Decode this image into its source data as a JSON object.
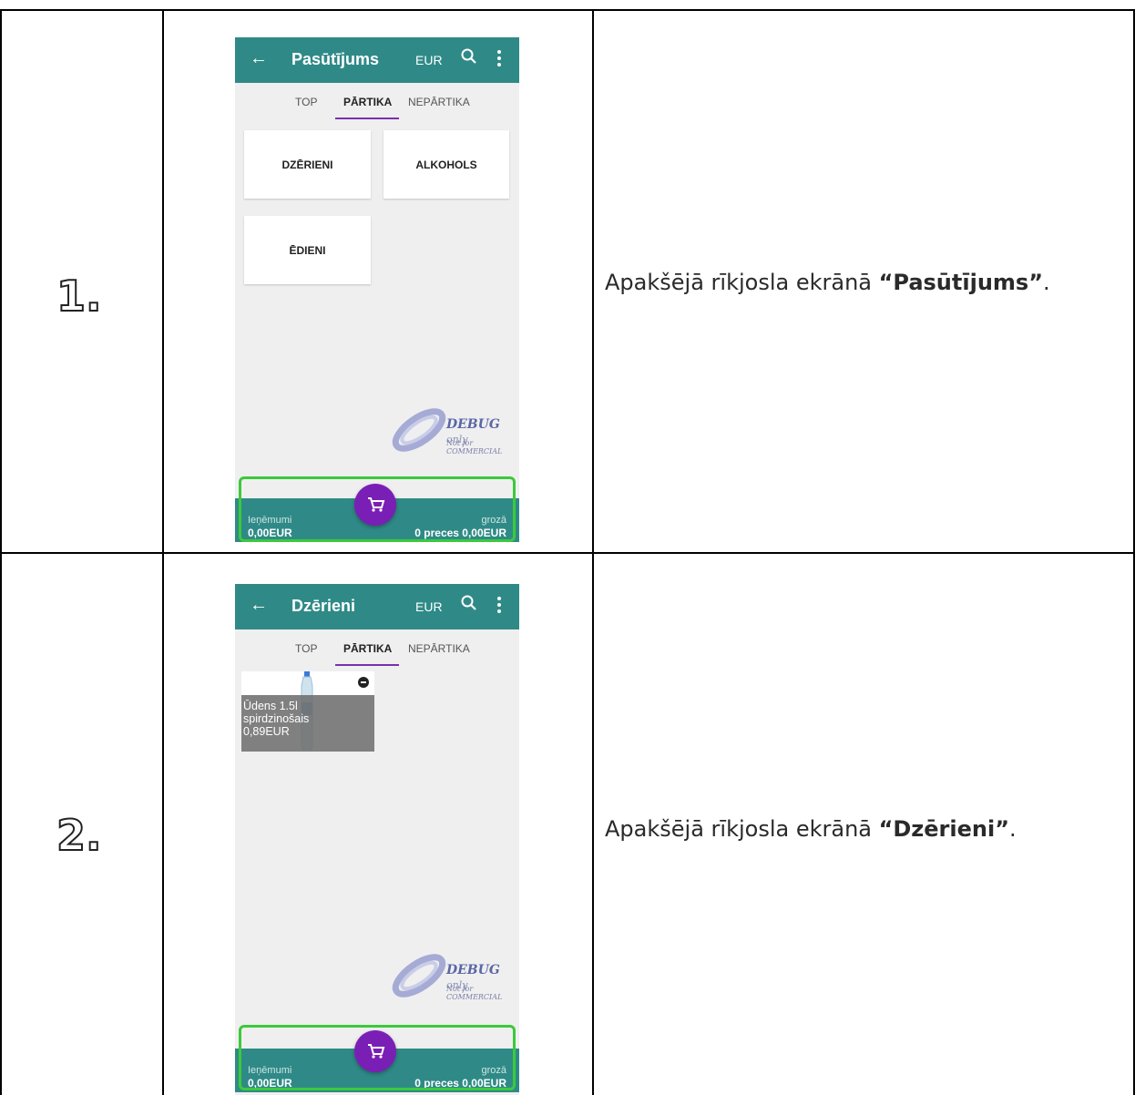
{
  "rows": [
    {
      "number": "1.",
      "description_prefix": "Apakšējā rīkjosla ekrānā ",
      "description_bold": "“Pasūtījums”",
      "description_suffix": ".",
      "screen": {
        "title": "Pasūtījums",
        "currency": "EUR",
        "tabs": [
          "TOP",
          "PĀRTIKA",
          "NEPĀRTIKA"
        ],
        "active_tab": "PĀRTIKA",
        "categories": [
          "DZĒRIENI",
          "ALKOHOLS",
          "ĒDIENI"
        ],
        "watermark_main": "DEBUG",
        "watermark_only": "only",
        "watermark_sub": "Not for COMMERCIAL",
        "bottom_left_label": "Ieņēmumi",
        "bottom_left_value": "0,00EUR",
        "bottom_right_label": "grozā",
        "bottom_right_value": "0 preces 0,00EUR"
      }
    },
    {
      "number": "2.",
      "description_prefix": "Apakšējā rīkjosla ekrānā ",
      "description_bold": "“Dzērieni”",
      "description_suffix": ".",
      "screen": {
        "title": "Dzērieni",
        "currency": "EUR",
        "tabs": [
          "TOP",
          "PĀRTIKA",
          "NEPĀRTIKA"
        ],
        "active_tab": "PĀRTIKA",
        "product": {
          "name_line1": "Ūdens 1.5l",
          "name_line2": "spirdzinošais",
          "price": "0,89EUR"
        },
        "watermark_main": "DEBUG",
        "watermark_only": "only",
        "watermark_sub": "Not for COMMERCIAL",
        "bottom_left_label": "Ieņēmumi",
        "bottom_left_value": "0,00EUR",
        "bottom_right_label": "grozā",
        "bottom_right_value": "0 preces 0,00EUR"
      }
    }
  ],
  "colors": {
    "appbar": "#2f8a87",
    "fab": "#7a1fb5",
    "tab_indicator": "#7b2fb0",
    "highlight": "#3cc93c"
  }
}
